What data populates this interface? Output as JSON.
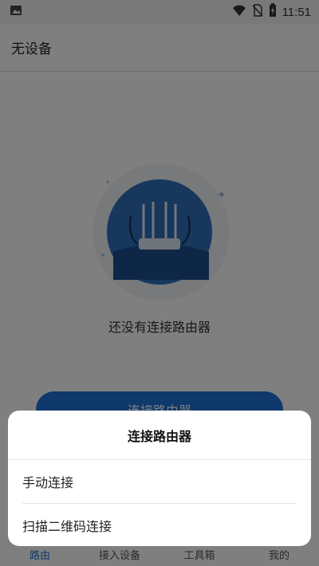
{
  "status_bar": {
    "time": "11:51",
    "icons": [
      "image-icon",
      "wifi-icon",
      "no-sim-icon",
      "battery-charging-icon"
    ]
  },
  "app_bar": {
    "title": "无设备"
  },
  "main": {
    "empty_message": "还没有连接路由器",
    "connect_button_label": "连接路由器"
  },
  "tabs": [
    {
      "label": "路由",
      "active": true
    },
    {
      "label": "接入设备",
      "active": false
    },
    {
      "label": "工具箱",
      "active": false
    },
    {
      "label": "我的",
      "active": false
    }
  ],
  "bottom_sheet": {
    "title": "连接路由器",
    "options": [
      "手动连接",
      "扫描二维码连接"
    ]
  },
  "colors": {
    "accent": "#1f73d6",
    "scrim": "rgba(0,0,0,0.5)"
  }
}
